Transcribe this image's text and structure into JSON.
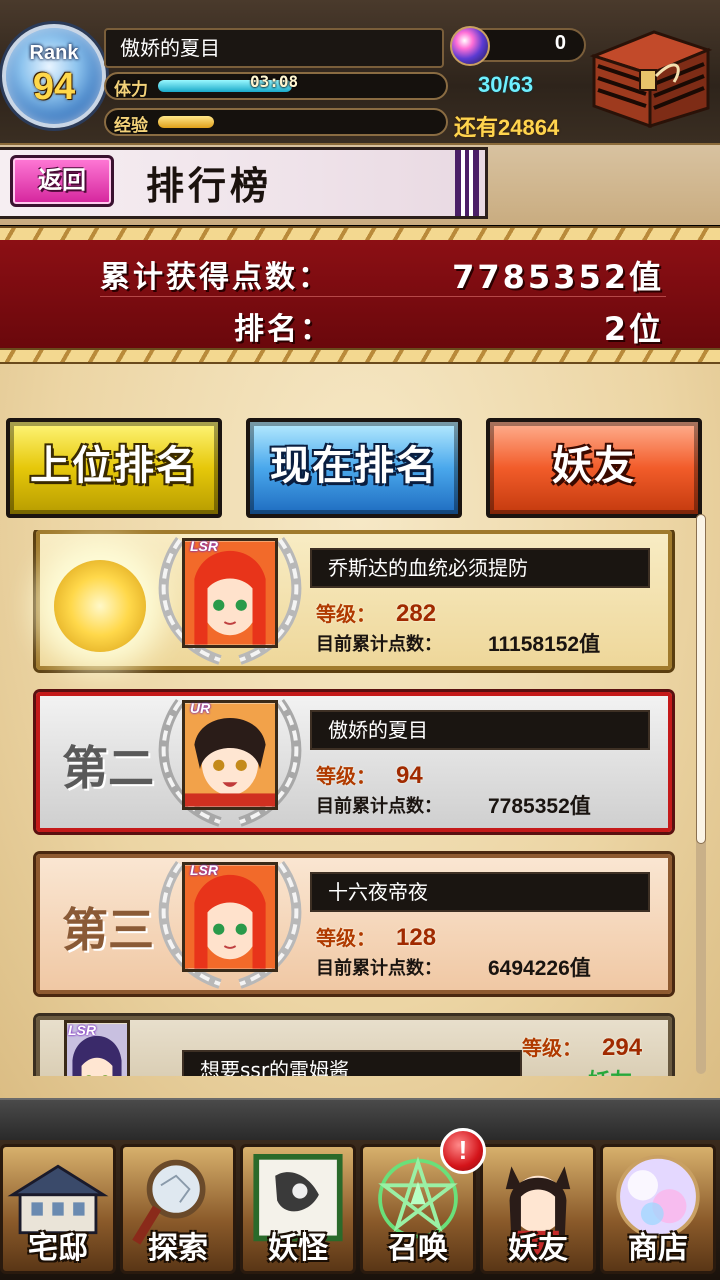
{
  "player": {
    "rank_label": "Rank",
    "rank": "94",
    "name": "傲娇的夏目",
    "stamina_label": "体力",
    "stamina_timer": "03:08",
    "stamina_count": "30/63",
    "stamina_fraction": 0.48,
    "exp_label": "经验",
    "exp_fraction": 0.2,
    "orb_count": "0",
    "remaining_prefix": "还有",
    "remaining_value": "24864"
  },
  "header": {
    "back_label": "返回",
    "title": "排行榜"
  },
  "score": {
    "total_label": "累计获得点数：",
    "total_value": "7785352值",
    "rank_label": "排名：",
    "rank_value": "2位"
  },
  "tabs": {
    "top": "上位排名",
    "current": "现在排名",
    "friends": "妖友"
  },
  "entries": [
    {
      "rank_text": "",
      "rarity": "LSR",
      "name": "乔斯达的血统必须提防",
      "level_label": "等级：",
      "level": "282",
      "points_label": "目前累计点数：",
      "points": "11158152",
      "points_unit": "值"
    },
    {
      "rank_text": "第二",
      "rarity": "UR",
      "name": "傲娇的夏目",
      "level_label": "等级：",
      "level": "94",
      "points_label": "目前累计点数：",
      "points": "7785352",
      "points_unit": "值"
    },
    {
      "rank_text": "第三",
      "rarity": "LSR",
      "name": "十六夜帝夜",
      "level_label": "等级：",
      "level": "128",
      "points_label": "目前累计点数：",
      "points": "6494226",
      "points_unit": "值"
    },
    {
      "rarity": "LSR",
      "name": "想要ssr的雷姆酱",
      "level_label": "等级：",
      "level": "294",
      "tag": "妖友"
    }
  ],
  "nav": [
    {
      "label": "宅邸",
      "icon": "mansion-icon"
    },
    {
      "label": "探索",
      "icon": "magnifier-icon"
    },
    {
      "label": "妖怪",
      "icon": "yokai-scroll-icon"
    },
    {
      "label": "召唤",
      "icon": "pentagram-icon"
    },
    {
      "label": "妖友",
      "icon": "fox-girl-icon"
    },
    {
      "label": "商店",
      "icon": "crystal-orb-icon"
    }
  ],
  "notification": "!",
  "colors": {
    "banner_red": "#8c0f14",
    "tab_yellow": "#e6c80a",
    "tab_blue": "#4aa8ec",
    "tab_orange": "#f25c2a",
    "stamina_cyan": "#19a9c9",
    "exp_gold": "#e0a01a"
  }
}
